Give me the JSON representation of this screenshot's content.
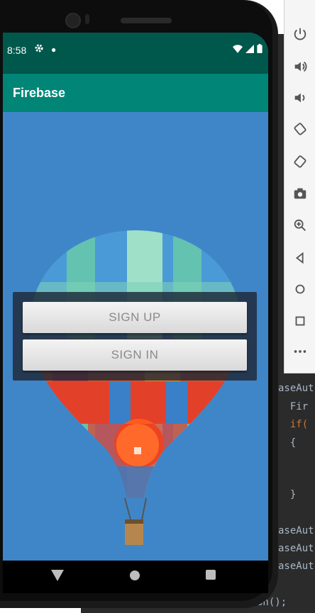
{
  "status_bar": {
    "time": "8:58"
  },
  "app_bar": {
    "title": "Firebase"
  },
  "buttons": {
    "sign_up": "SIGN UP",
    "sign_in": "SIGN IN"
  },
  "editor_lines": [
    {
      "text": "aseAut"
    },
    {
      "text": "  Fir"
    },
    {
      "text": "  if("
    },
    {
      "text": "  {"
    },
    {
      "text": "  }"
    },
    {
      "text": "aseAut"
    },
    {
      "text": "aseAut"
    },
    {
      "text": "aseAut"
    },
    {
      "text": "on();"
    }
  ],
  "toolbar_icons": [
    "power-icon",
    "volume-up-icon",
    "volume-down-icon",
    "rotate-left-icon",
    "rotate-right-icon",
    "camera-icon",
    "zoom-icon",
    "back-icon",
    "home-icon",
    "overview-icon",
    "more-icon"
  ],
  "colors": {
    "status_bar": "#00574b",
    "app_bar": "#008577",
    "sky": "#3f86c8"
  }
}
